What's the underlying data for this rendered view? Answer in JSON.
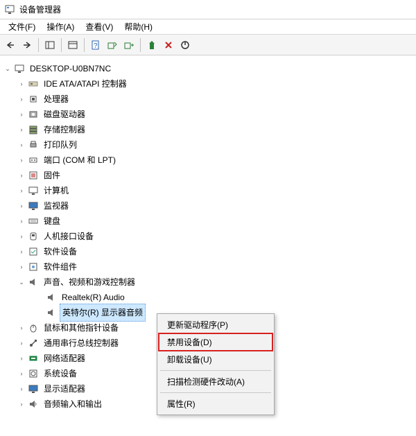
{
  "title": "设备管理器",
  "menubar": {
    "file": "文件(F)",
    "action": "操作(A)",
    "view": "查看(V)",
    "help": "帮助(H)"
  },
  "tree": {
    "root": "DESKTOP-U0BN7NC",
    "categories": [
      {
        "label": "IDE ATA/ATAPI 控制器",
        "icon": "ide"
      },
      {
        "label": "处理器",
        "icon": "cpu"
      },
      {
        "label": "磁盘驱动器",
        "icon": "disk"
      },
      {
        "label": "存储控制器",
        "icon": "storage"
      },
      {
        "label": "打印队列",
        "icon": "printer"
      },
      {
        "label": "端口 (COM 和 LPT)",
        "icon": "port"
      },
      {
        "label": "固件",
        "icon": "firmware"
      },
      {
        "label": "计算机",
        "icon": "computer"
      },
      {
        "label": "监视器",
        "icon": "monitor"
      },
      {
        "label": "键盘",
        "icon": "keyboard"
      },
      {
        "label": "人机接口设备",
        "icon": "hid"
      },
      {
        "label": "软件设备",
        "icon": "software"
      },
      {
        "label": "软件组件",
        "icon": "component"
      }
    ],
    "sound_category": "声音、视频和游戏控制器",
    "sound_children": [
      "Realtek(R) Audio",
      "英特尔(R) 显示器音频"
    ],
    "categories_after": [
      {
        "label": "鼠标和其他指针设备",
        "icon": "mouse"
      },
      {
        "label": "通用串行总线控制器",
        "icon": "usb"
      },
      {
        "label": "网络适配器",
        "icon": "network"
      },
      {
        "label": "系统设备",
        "icon": "system"
      },
      {
        "label": "显示适配器",
        "icon": "display"
      },
      {
        "label": "音频输入和输出",
        "icon": "audio"
      }
    ]
  },
  "context_menu": {
    "update": "更新驱动程序(P)",
    "disable": "禁用设备(D)",
    "uninstall": "卸载设备(U)",
    "scan": "扫描检测硬件改动(A)",
    "properties": "属性(R)"
  }
}
